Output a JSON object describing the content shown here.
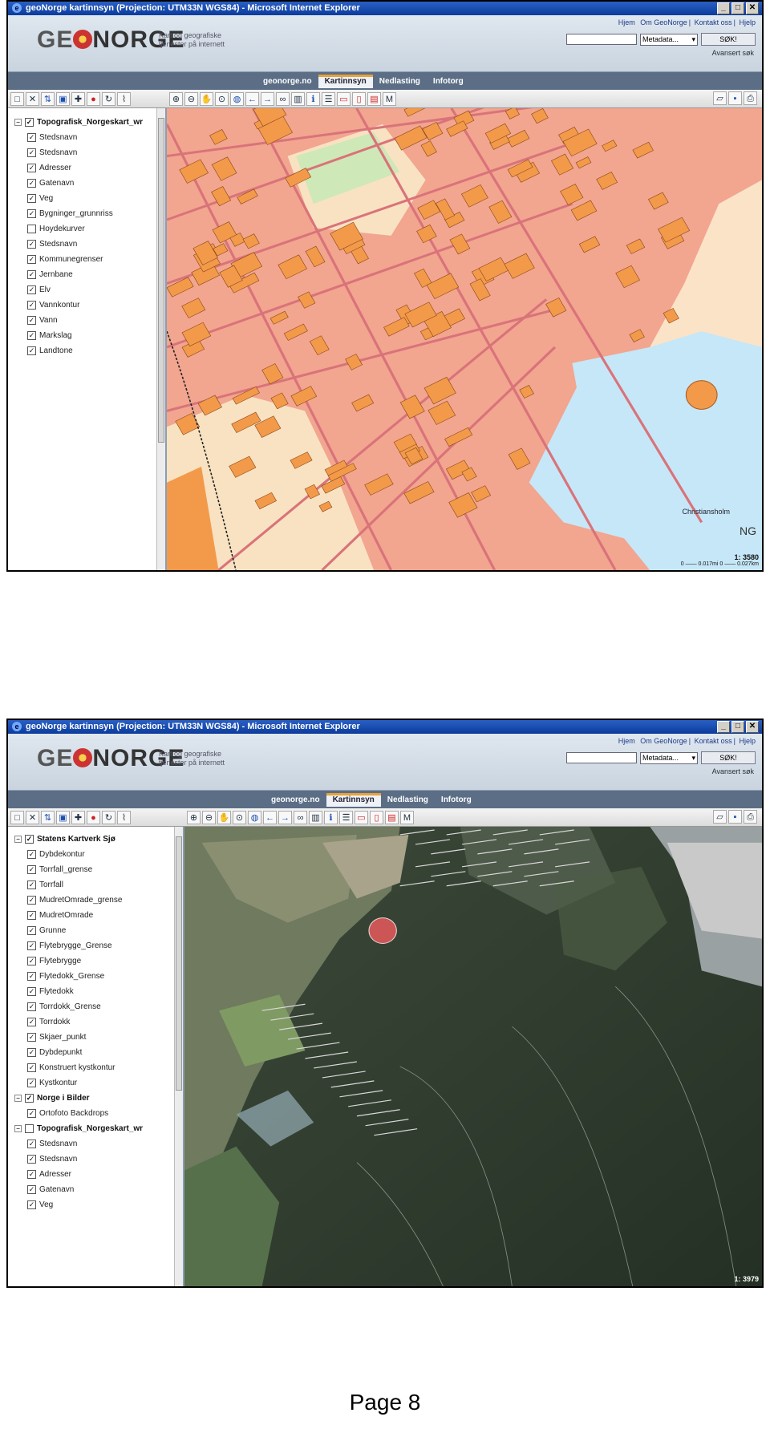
{
  "screenshot1": {
    "window_title": "geoNorge kartinnsyn (Projection: UTM33N WGS84) - Microsoft Internet Explorer",
    "header": {
      "logo": "GEONORGE",
      "tagline": "Kart og geografiske tjenester på internett",
      "links": [
        "Hjem",
        "Om GeoNorge",
        "Kontakt oss",
        "Hjelp"
      ],
      "metadata_select": "Metadata...",
      "search_button": "SØK!",
      "advanced_search": "Avansert søk"
    },
    "tabs": [
      "geonorge.no",
      "Kartinnsyn",
      "Nedlasting",
      "Infotorg"
    ],
    "active_tab": "Kartinnsyn",
    "layers": [
      {
        "label": "Topografisk_Norgeskart_wr",
        "group": true,
        "checked": true
      },
      {
        "label": "Stedsnavn",
        "checked": true
      },
      {
        "label": "Stedsnavn",
        "checked": true
      },
      {
        "label": "Adresser",
        "checked": true
      },
      {
        "label": "Gatenavn",
        "checked": true
      },
      {
        "label": "Veg",
        "checked": true
      },
      {
        "label": "Bygninger_grunnriss",
        "checked": true
      },
      {
        "label": "Hoydekurver",
        "checked": false
      },
      {
        "label": "Stedsnavn",
        "checked": true
      },
      {
        "label": "Kommunegrenser",
        "checked": true
      },
      {
        "label": "Jernbane",
        "checked": true
      },
      {
        "label": "Elv",
        "checked": true
      },
      {
        "label": "Vannkontur",
        "checked": true
      },
      {
        "label": "Vann",
        "checked": true
      },
      {
        "label": "Markslag",
        "checked": true
      },
      {
        "label": "Landtone",
        "checked": true
      }
    ],
    "map_label": "Christiansholm",
    "scale": "1: 3580",
    "scalebar": "0 —— 0.017mi 0 —— 0.027km",
    "side_text": "NG"
  },
  "screenshot2": {
    "window_title": "geoNorge kartinnsyn (Projection: UTM33N WGS84) - Microsoft Internet Explorer",
    "header": {
      "logo": "GEONORGE",
      "tagline": "Kart og geografiske tjenester på internett",
      "links": [
        "Hjem",
        "Om GeoNorge",
        "Kontakt oss",
        "Hjelp"
      ],
      "metadata_select": "Metadata...",
      "search_button": "SØK!",
      "advanced_search": "Avansert søk"
    },
    "tabs": [
      "geonorge.no",
      "Kartinnsyn",
      "Nedlasting",
      "Infotorg"
    ],
    "active_tab": "Kartinnsyn",
    "layers": [
      {
        "label": "Statens Kartverk Sjø",
        "group": true,
        "checked": true
      },
      {
        "label": "Dybdekontur",
        "checked": true
      },
      {
        "label": "Torrfall_grense",
        "checked": true
      },
      {
        "label": "Torrfall",
        "checked": true
      },
      {
        "label": "MudretOmrade_grense",
        "checked": true
      },
      {
        "label": "MudretOmrade",
        "checked": true
      },
      {
        "label": "Grunne",
        "checked": true
      },
      {
        "label": "Flytebrygge_Grense",
        "checked": true
      },
      {
        "label": "Flytebrygge",
        "checked": true
      },
      {
        "label": "Flytedokk_Grense",
        "checked": true
      },
      {
        "label": "Flytedokk",
        "checked": true
      },
      {
        "label": "Torrdokk_Grense",
        "checked": true
      },
      {
        "label": "Torrdokk",
        "checked": true
      },
      {
        "label": "Skjaer_punkt",
        "checked": true
      },
      {
        "label": "Dybdepunkt",
        "checked": true
      },
      {
        "label": "Konstruert kystkontur",
        "checked": true
      },
      {
        "label": "Kystkontur",
        "checked": true
      },
      {
        "label": "Norge i Bilder",
        "group": true,
        "checked": true
      },
      {
        "label": "Ortofoto Backdrops",
        "checked": true
      },
      {
        "label": "Topografisk_Norgeskart_wr",
        "group": true,
        "checked": false
      },
      {
        "label": "Stedsnavn",
        "checked": true
      },
      {
        "label": "Stedsnavn",
        "checked": true
      },
      {
        "label": "Adresser",
        "checked": true
      },
      {
        "label": "Gatenavn",
        "checked": true
      },
      {
        "label": "Veg",
        "checked": true
      }
    ],
    "scale": "1: 3979"
  },
  "page_label": "Page 8"
}
